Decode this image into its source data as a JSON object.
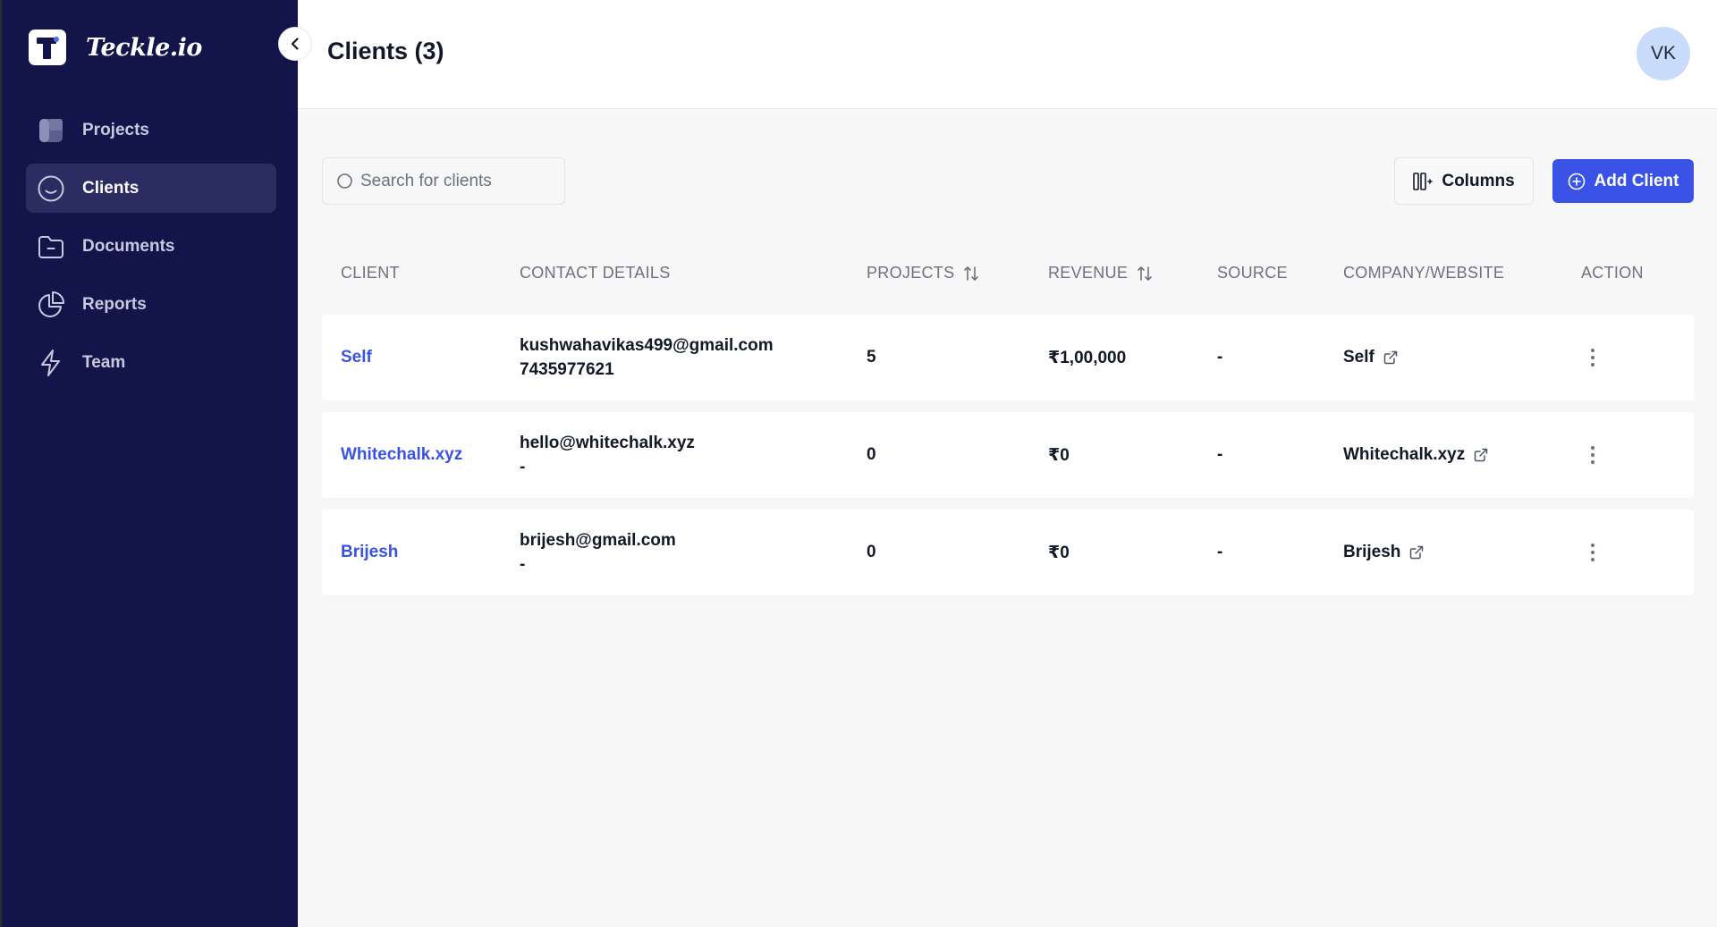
{
  "brand": {
    "name": "Teckle.io"
  },
  "sidebar": {
    "items": [
      {
        "label": "Projects",
        "icon": "projects-icon"
      },
      {
        "label": "Clients",
        "icon": "smile-icon",
        "active": true
      },
      {
        "label": "Documents",
        "icon": "folder-icon"
      },
      {
        "label": "Reports",
        "icon": "pie-chart-icon"
      },
      {
        "label": "Team",
        "icon": "lightning-icon"
      }
    ]
  },
  "header": {
    "title": "Clients (3)",
    "avatar_initials": "VK"
  },
  "toolbar": {
    "search_placeholder": "Search for clients",
    "columns_label": "Columns",
    "add_label": "Add Client"
  },
  "table": {
    "headers": {
      "client": "CLIENT",
      "contact": "CONTACT DETAILS",
      "projects": "PROJECTS",
      "revenue": "REVENUE",
      "source": "SOURCE",
      "company": "COMPANY/WEBSITE",
      "action": "ACTION"
    },
    "rows": [
      {
        "client": "Self",
        "email": "kushwahavikas499@gmail.com",
        "phone": "7435977621",
        "projects": "5",
        "revenue": "₹1,00,000",
        "source": "-",
        "company": "Self"
      },
      {
        "client": "Whitechalk.xyz",
        "email": "hello@whitechalk.xyz",
        "phone": "-",
        "projects": "0",
        "revenue": "₹0",
        "source": "-",
        "company": "Whitechalk.xyz"
      },
      {
        "client": "Brijesh",
        "email": "brijesh@gmail.com",
        "phone": "-",
        "projects": "0",
        "revenue": "₹0",
        "source": "-",
        "company": "Brijesh"
      }
    ]
  },
  "colors": {
    "sidebar_bg": "#13144a",
    "accent": "#3b52e6",
    "avatar_bg": "#c9dcfb"
  }
}
